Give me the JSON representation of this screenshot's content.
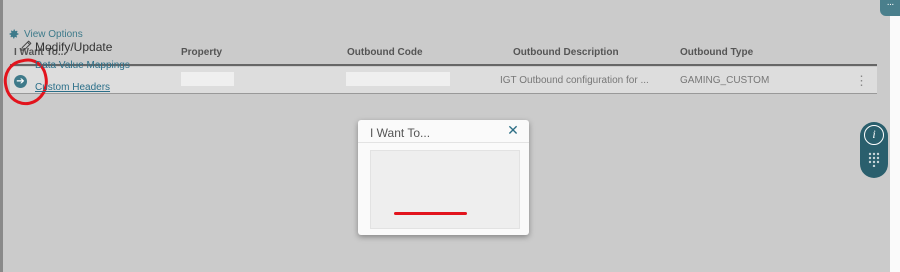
{
  "toolbar": {
    "view_options_label": "View Options",
    "overflow_label": "···"
  },
  "table": {
    "columns": [
      "I Want To...",
      "Property",
      "Outbound Code",
      "Outbound Description",
      "Outbound Type"
    ],
    "rows": [
      {
        "property": "",
        "outbound_code": "",
        "outbound_description": "IGT Outbound configuration for ...",
        "outbound_type": "GAMING_CUSTOM",
        "menu_label": "⋮"
      }
    ]
  },
  "popup": {
    "title": "I Want To...",
    "close_label": "✕",
    "section_label": "Modify/Update",
    "links": [
      "Data Value Mappings",
      "Custom Headers"
    ]
  },
  "widget": {
    "info_label": "i"
  },
  "colors": {
    "accent": "#3f7a8a",
    "annotation_red": "#e2141d",
    "overlay_gray": "#cbcbcb"
  }
}
